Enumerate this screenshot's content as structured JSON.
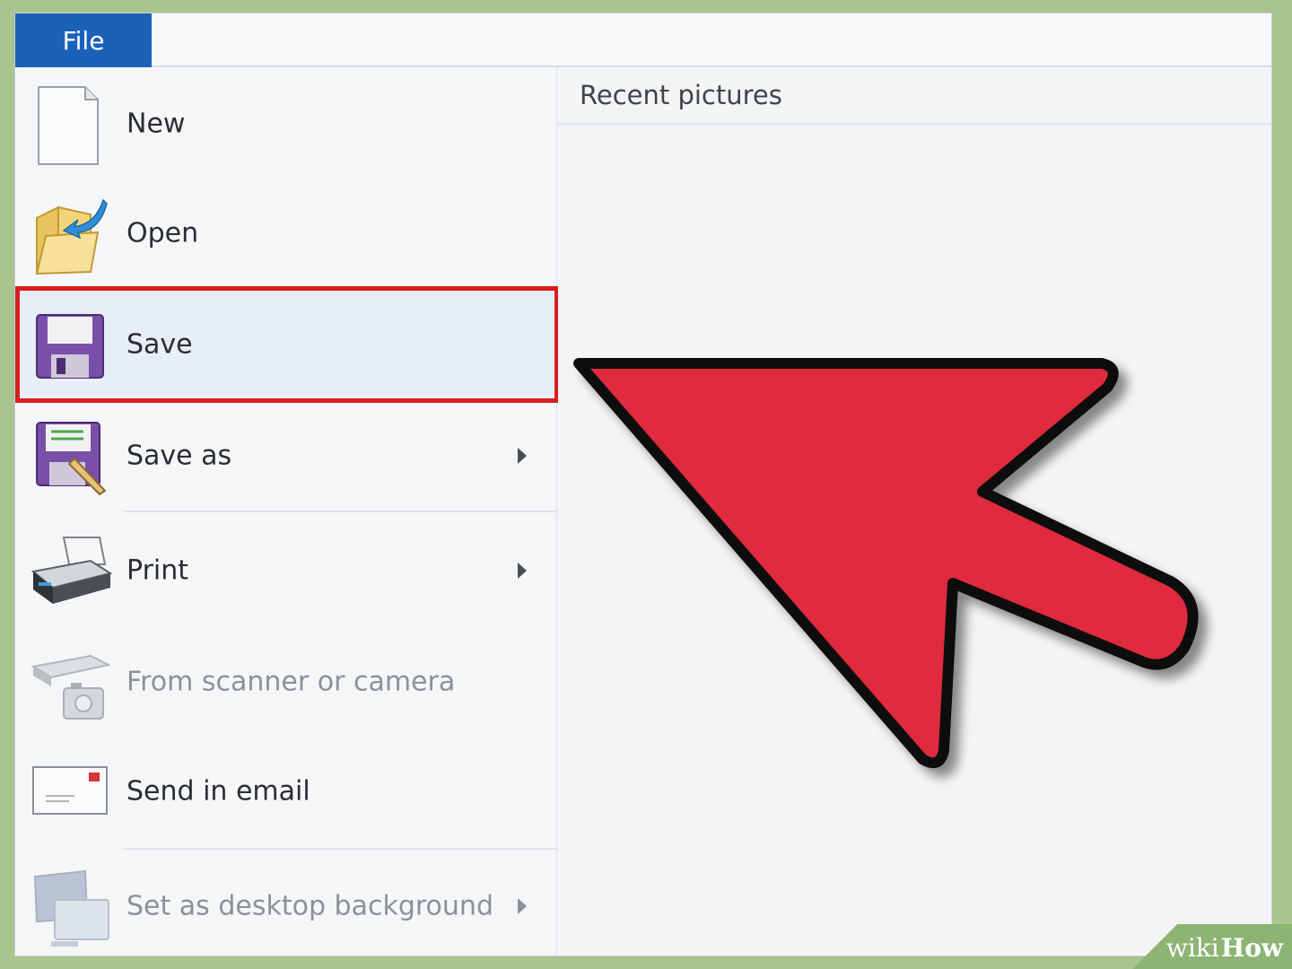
{
  "ribbon": {
    "file_tab": "File"
  },
  "menu": {
    "items": [
      {
        "label": "New",
        "icon": "new-document-icon",
        "has_submenu": false,
        "enabled": true
      },
      {
        "label": "Open",
        "icon": "open-folder-icon",
        "has_submenu": false,
        "enabled": true
      },
      {
        "label": "Save",
        "icon": "save-floppy-icon",
        "has_submenu": false,
        "enabled": true,
        "highlighted": true
      },
      {
        "label": "Save as",
        "icon": "save-as-icon",
        "has_submenu": true,
        "enabled": true
      },
      {
        "label": "Print",
        "icon": "printer-icon",
        "has_submenu": true,
        "enabled": true
      },
      {
        "label": "From scanner or camera",
        "icon": "scanner-camera-icon",
        "has_submenu": false,
        "enabled": false
      },
      {
        "label": "Send in email",
        "icon": "email-icon",
        "has_submenu": false,
        "enabled": true
      },
      {
        "label": "Set as desktop background",
        "icon": "desktop-background-icon",
        "has_submenu": true,
        "enabled": false
      }
    ]
  },
  "recent": {
    "title": "Recent pictures"
  },
  "annotation": {
    "arrow_color": "#e02a3c",
    "highlight_color": "#d81e1e"
  },
  "watermark": {
    "wiki": "wiki",
    "how": "How"
  }
}
